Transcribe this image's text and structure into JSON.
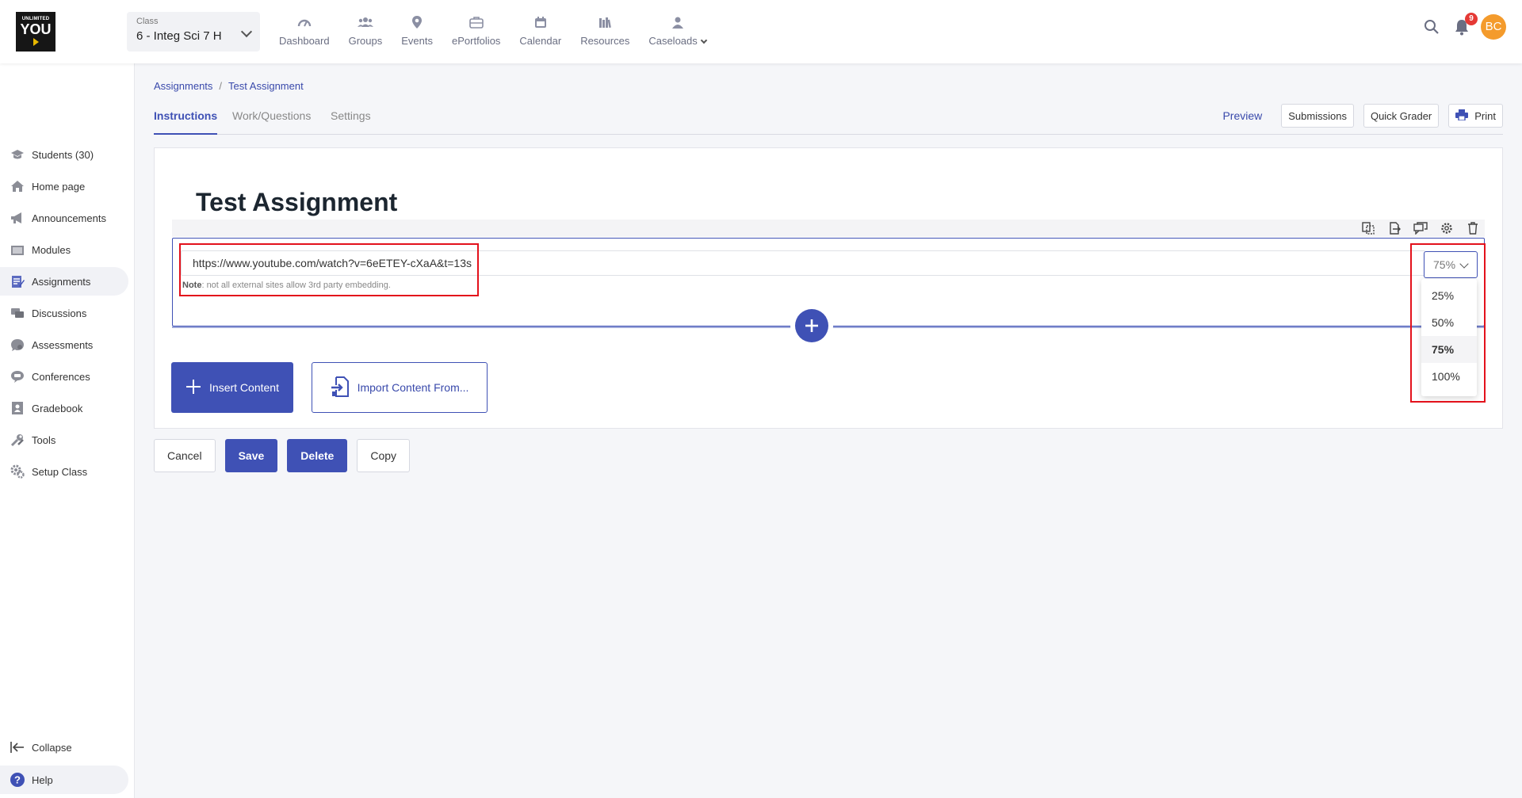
{
  "logo": {
    "line1": "UNLIMITED",
    "line2": "YOU"
  },
  "class_selector": {
    "label": "Class",
    "value": "6 - Integ Sci 7 H"
  },
  "top_nav": [
    {
      "label": "Dashboard",
      "icon": "gauge-icon"
    },
    {
      "label": "Groups",
      "icon": "people-icon"
    },
    {
      "label": "Events",
      "icon": "location-pin-icon"
    },
    {
      "label": "ePortfolios",
      "icon": "briefcase-icon"
    },
    {
      "label": "Calendar",
      "icon": "calendar-icon"
    },
    {
      "label": "Resources",
      "icon": "books-icon"
    },
    {
      "label": "Caseloads",
      "icon": "person-icon"
    }
  ],
  "header_right": {
    "notification_count": "9",
    "avatar_initials": "BC"
  },
  "sidebar": {
    "items": [
      {
        "label": "Students (30)",
        "icon": "students-icon"
      },
      {
        "label": "Home page",
        "icon": "home-icon"
      },
      {
        "label": "Announcements",
        "icon": "megaphone-icon"
      },
      {
        "label": "Modules",
        "icon": "folder-icon"
      },
      {
        "label": "Assignments",
        "icon": "assignment-icon"
      },
      {
        "label": "Discussions",
        "icon": "chat-bubbles-icon"
      },
      {
        "label": "Assessments",
        "icon": "assessment-icon"
      },
      {
        "label": "Conferences",
        "icon": "conference-icon"
      },
      {
        "label": "Gradebook",
        "icon": "gradebook-icon"
      },
      {
        "label": "Tools",
        "icon": "wrench-icon"
      },
      {
        "label": "Setup Class",
        "icon": "gear-icon"
      }
    ],
    "active": "Assignments",
    "collapse_label": "Collapse",
    "help_label": "Help"
  },
  "breadcrumb": {
    "parent": "Assignments",
    "separator": "/",
    "current": "Test Assignment"
  },
  "tabs": [
    {
      "label": "Instructions"
    },
    {
      "label": "Work/Questions"
    },
    {
      "label": "Settings"
    }
  ],
  "active_tab": "Instructions",
  "page_actions": {
    "preview": "Preview",
    "submissions": "Submissions",
    "quick_grader": "Quick Grader",
    "print": "Print"
  },
  "editor": {
    "title": "Test Assignment",
    "url_value": "https://www.youtube.com/watch?v=6eETEY-cXaA&t=13s",
    "note_bold": "Note",
    "note_text": ": not all external sites allow 3rd party embedding.",
    "size_value": "75%",
    "size_options": [
      "25%",
      "50%",
      "75%",
      "100%"
    ],
    "size_selected": "75%",
    "insert_label": "Insert Content",
    "import_label": "Import Content From..."
  },
  "footer_actions": {
    "cancel": "Cancel",
    "save": "Save",
    "delete": "Delete",
    "copy": "Copy"
  },
  "colors": {
    "primary": "#3f51b5",
    "highlight": "#e3111b",
    "avatar": "#f49b2c",
    "badge": "#e53935"
  }
}
